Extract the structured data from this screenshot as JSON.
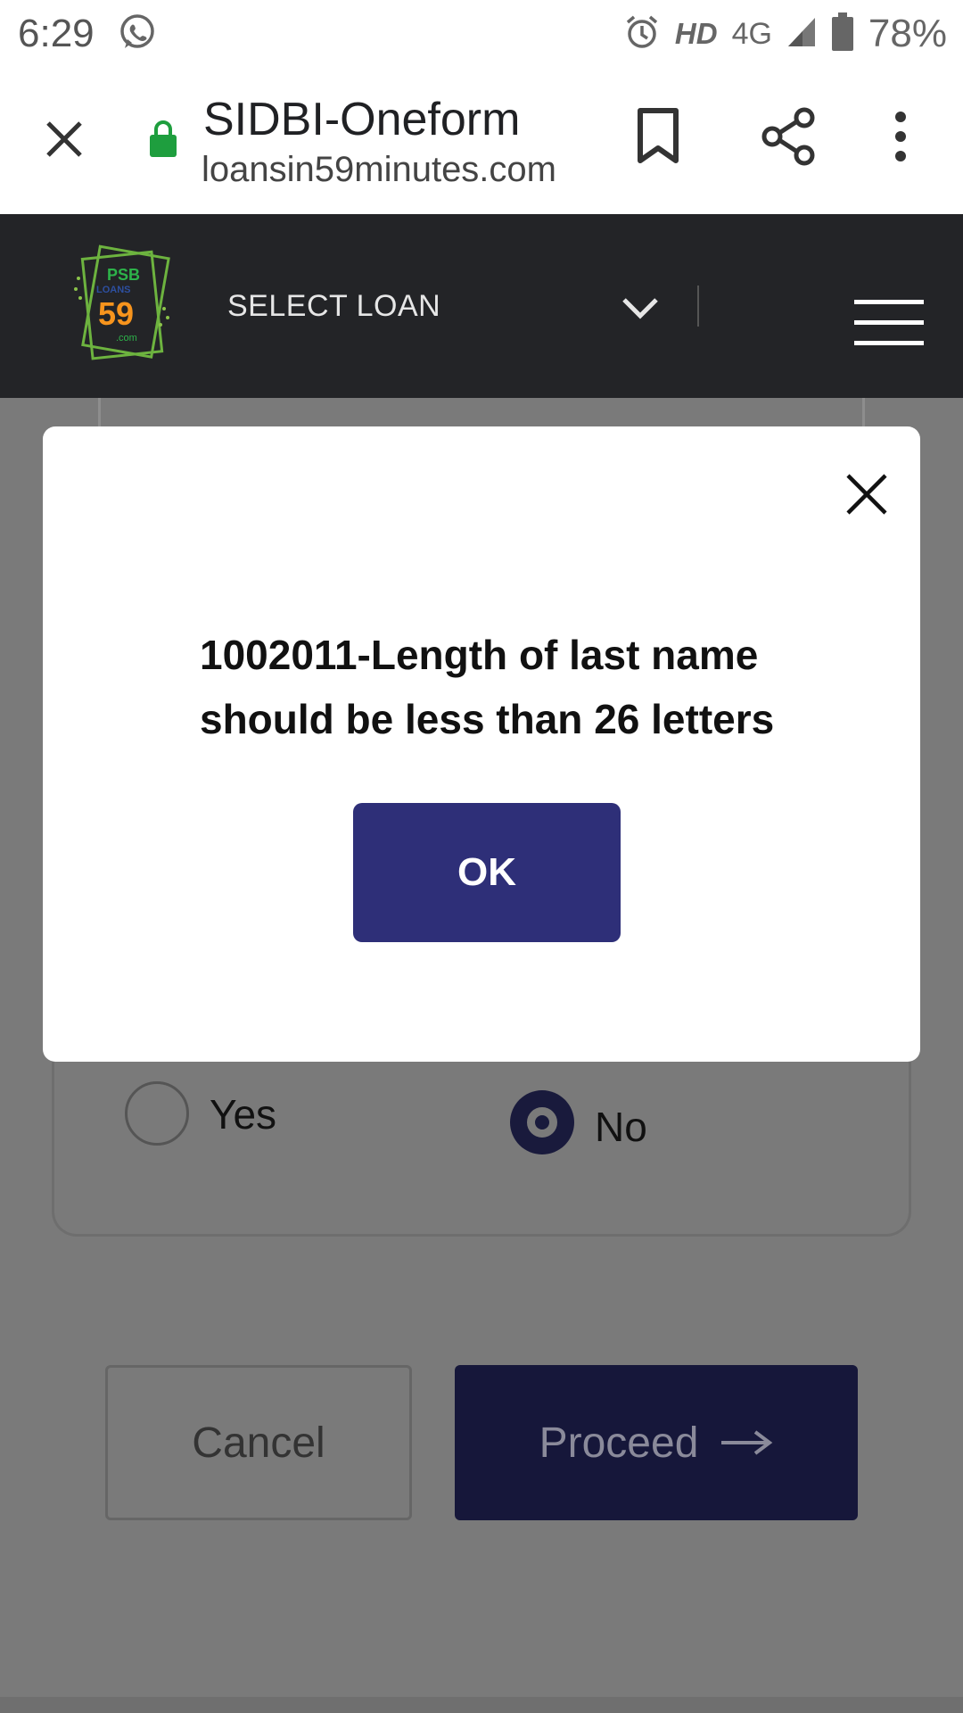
{
  "status_bar": {
    "time": "6:29",
    "hd": "HD",
    "network": "4G",
    "battery": "78%"
  },
  "browser": {
    "title": "SIDBI-Oneform",
    "url": "loansin59minutes.com"
  },
  "header": {
    "select_loan": "SELECT LOAN",
    "logo_text": "PSB LOANS 59 .com"
  },
  "form": {
    "options": {
      "yes": "Yes",
      "no": "No",
      "selected": "No"
    },
    "cancel_label": "Cancel",
    "proceed_label": "Proceed"
  },
  "modal": {
    "message": "1002011-Length of last name should be less than 26 letters",
    "ok_label": "OK"
  },
  "colors": {
    "header_bg": "#232427",
    "ok_button": "#2e2f78",
    "proceed_button": "#16173a",
    "lock": "#1e9e3e"
  }
}
